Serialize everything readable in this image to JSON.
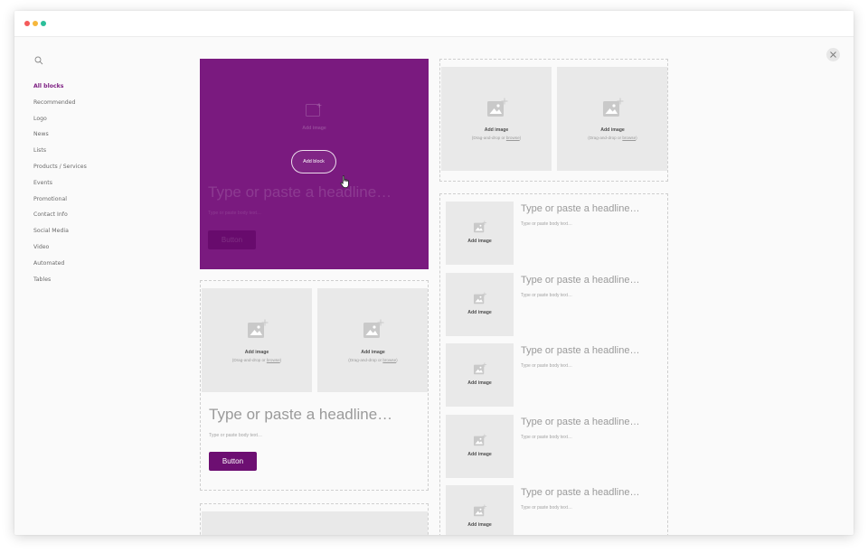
{
  "window": {
    "dots": [
      "close",
      "minimize",
      "maximize"
    ]
  },
  "sidebar": {
    "search_icon": "search-icon",
    "items": [
      {
        "label": "All blocks",
        "active": true
      },
      {
        "label": "Recommended"
      },
      {
        "label": "Logo"
      },
      {
        "label": "News"
      },
      {
        "label": "Lists"
      },
      {
        "label": "Products / Services"
      },
      {
        "label": "Events"
      },
      {
        "label": "Promotional"
      },
      {
        "label": "Contact Info"
      },
      {
        "label": "Social Media"
      },
      {
        "label": "Video"
      },
      {
        "label": "Automated"
      },
      {
        "label": "Tables"
      }
    ]
  },
  "placeholders": {
    "add_image": "Add image",
    "drag_prefix": "(Drag-and-drop or ",
    "browse": "browse",
    "drag_suffix": ")",
    "headline": "Type or paste a headline…",
    "body": "Type or paste body text…",
    "button": "Button"
  },
  "hover_block": {
    "add_block_label": "Add block",
    "ghost_add_image": "Add image",
    "ghost_headline": "Type or paste a headline…",
    "ghost_body": "Type or paste body text…",
    "ghost_button": "Button"
  },
  "colors": {
    "brand_purple": "#7a1a7f",
    "button_purple": "#6d0f72",
    "placeholder_gray": "#e9e9e9"
  }
}
